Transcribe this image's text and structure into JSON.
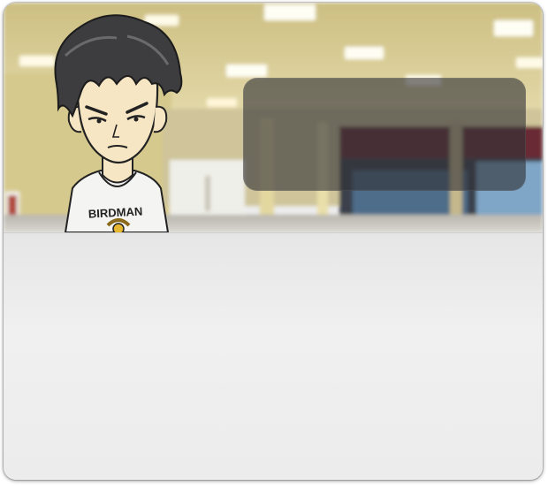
{
  "scene": {
    "background": "blurred-indoor-hall",
    "character": {
      "name": "",
      "shirt_text": "BIRDMAN",
      "expression": "annoyed"
    }
  },
  "info_box": {
    "text": ""
  },
  "dialog": {
    "text": ""
  },
  "colors": {
    "panel": "#ececec",
    "overlay": "rgba(50,50,55,0.62)",
    "wall": "#d9cc94",
    "hair": "#3a3a3a",
    "skin": "#f7e6c4"
  }
}
